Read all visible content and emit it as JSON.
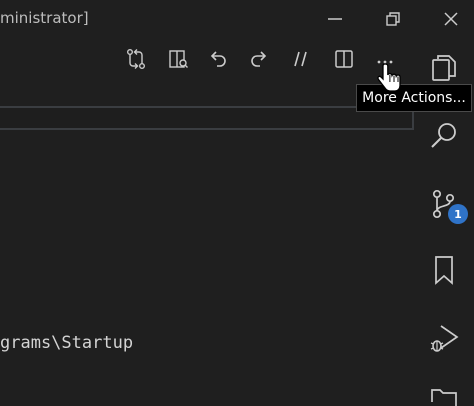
{
  "window": {
    "title": "[Administrator]",
    "title_visible": "ministrator]"
  },
  "window_controls": [
    "minimize-icon",
    "restore-icon",
    "close-icon"
  ],
  "toolbar": {
    "buttons": [
      {
        "name": "compare-changes-button",
        "icon": "git-compare-icon"
      },
      {
        "name": "open-changes-button",
        "icon": "go-to-file-icon"
      },
      {
        "name": "undo-button",
        "icon": "undo-icon"
      },
      {
        "name": "redo-button",
        "icon": "redo-icon"
      },
      {
        "name": "toggle-comment-button",
        "icon": "comment-slashes-icon"
      },
      {
        "name": "split-editor-button",
        "icon": "split-editor-icon"
      },
      {
        "name": "more-actions-button",
        "icon": "ellipsis-icon"
      }
    ]
  },
  "tooltip": {
    "text": "More Actions..."
  },
  "editor": {
    "visible_line": "grams\\Startup"
  },
  "activity_bar": {
    "items": [
      {
        "name": "explorer",
        "icon": "files-icon"
      },
      {
        "name": "search",
        "icon": "search-icon"
      },
      {
        "name": "source-control",
        "icon": "source-control-icon",
        "badge": "1"
      },
      {
        "name": "bookmarks",
        "icon": "bookmark-icon"
      },
      {
        "name": "run-and-debug",
        "icon": "run-debug-icon"
      },
      {
        "name": "folder",
        "icon": "folder-icon"
      }
    ]
  },
  "colors": {
    "background": "#1f1f1f",
    "icon": "#cccccc",
    "badge": "#2f73c8",
    "tooltip_bg": "#000000"
  }
}
